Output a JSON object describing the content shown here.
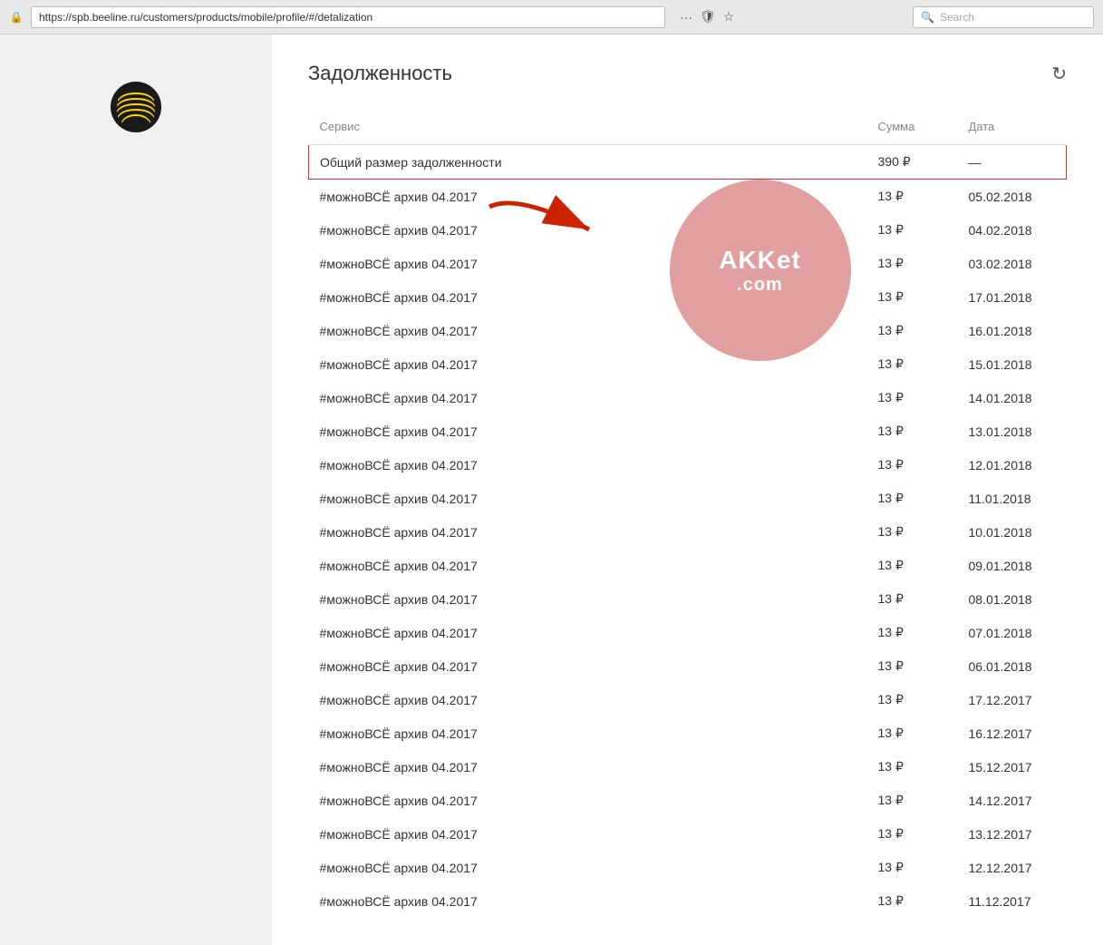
{
  "browser": {
    "url": "https://spb.beeline.ru/customers/products/mobile/profile/#/detalization",
    "search_placeholder": "Search",
    "menu_icon": "···",
    "bookmark_icon": "☆",
    "shield_icon": "🛡"
  },
  "page": {
    "title": "Задолженность",
    "refresh_label": "↻"
  },
  "table": {
    "columns": [
      {
        "id": "service",
        "label": "Сервис"
      },
      {
        "id": "amount",
        "label": "Сумма"
      },
      {
        "id": "date",
        "label": "Дата"
      }
    ],
    "summary_row": {
      "service": "Общий размер задолженности",
      "amount": "390 ₽",
      "date": "—"
    },
    "rows": [
      {
        "service": "#можноВСЁ архив 04.2017",
        "amount": "13 ₽",
        "date": "05.02.2018"
      },
      {
        "service": "#можноВСЁ архив 04.2017",
        "amount": "13 ₽",
        "date": "04.02.2018"
      },
      {
        "service": "#можноВСЁ архив 04.2017",
        "amount": "13 ₽",
        "date": "03.02.2018"
      },
      {
        "service": "#можноВСЁ архив 04.2017",
        "amount": "13 ₽",
        "date": "17.01.2018"
      },
      {
        "service": "#можноВСЁ архив 04.2017",
        "amount": "13 ₽",
        "date": "16.01.2018"
      },
      {
        "service": "#можноВСЁ архив 04.2017",
        "amount": "13 ₽",
        "date": "15.01.2018"
      },
      {
        "service": "#можноВСЁ архив 04.2017",
        "amount": "13 ₽",
        "date": "14.01.2018"
      },
      {
        "service": "#можноВСЁ архив 04.2017",
        "amount": "13 ₽",
        "date": "13.01.2018"
      },
      {
        "service": "#можноВСЁ архив 04.2017",
        "amount": "13 ₽",
        "date": "12.01.2018"
      },
      {
        "service": "#можноВСЁ архив 04.2017",
        "amount": "13 ₽",
        "date": "11.01.2018"
      },
      {
        "service": "#можноВСЁ архив 04.2017",
        "amount": "13 ₽",
        "date": "10.01.2018"
      },
      {
        "service": "#можноВСЁ архив 04.2017",
        "amount": "13 ₽",
        "date": "09.01.2018"
      },
      {
        "service": "#можноВСЁ архив 04.2017",
        "amount": "13 ₽",
        "date": "08.01.2018"
      },
      {
        "service": "#можноВСЁ архив 04.2017",
        "amount": "13 ₽",
        "date": "07.01.2018"
      },
      {
        "service": "#можноВСЁ архив 04.2017",
        "amount": "13 ₽",
        "date": "06.01.2018"
      },
      {
        "service": "#можноВСЁ архив 04.2017",
        "amount": "13 ₽",
        "date": "17.12.2017"
      },
      {
        "service": "#можноВСЁ архив 04.2017",
        "amount": "13 ₽",
        "date": "16.12.2017"
      },
      {
        "service": "#можноВСЁ архив 04.2017",
        "amount": "13 ₽",
        "date": "15.12.2017"
      },
      {
        "service": "#можноВСЁ архив 04.2017",
        "amount": "13 ₽",
        "date": "14.12.2017"
      },
      {
        "service": "#можноВСЁ архив 04.2017",
        "amount": "13 ₽",
        "date": "13.12.2017"
      },
      {
        "service": "#можноВСЁ архив 04.2017",
        "amount": "13 ₽",
        "date": "12.12.2017"
      },
      {
        "service": "#можноВСЁ архив 04.2017",
        "amount": "13 ₽",
        "date": "11.12.2017"
      }
    ],
    "watermark": {
      "line1": "AKKet",
      "line2": ".com"
    }
  }
}
